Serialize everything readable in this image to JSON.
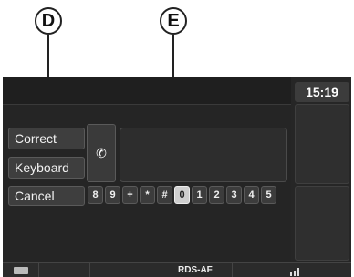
{
  "callouts": {
    "d": "D",
    "e": "E"
  },
  "clock": "15:19",
  "buttons": {
    "correct": "Correct",
    "keyboard": "Keyboard",
    "cancel": "Cancel"
  },
  "phone_glyph": "✆",
  "keys": [
    "8",
    "9",
    "+",
    "*",
    "#",
    "0",
    "1",
    "2",
    "3",
    "4",
    "5"
  ],
  "selected_key": "0",
  "status": {
    "rds": "RDS-AF"
  }
}
